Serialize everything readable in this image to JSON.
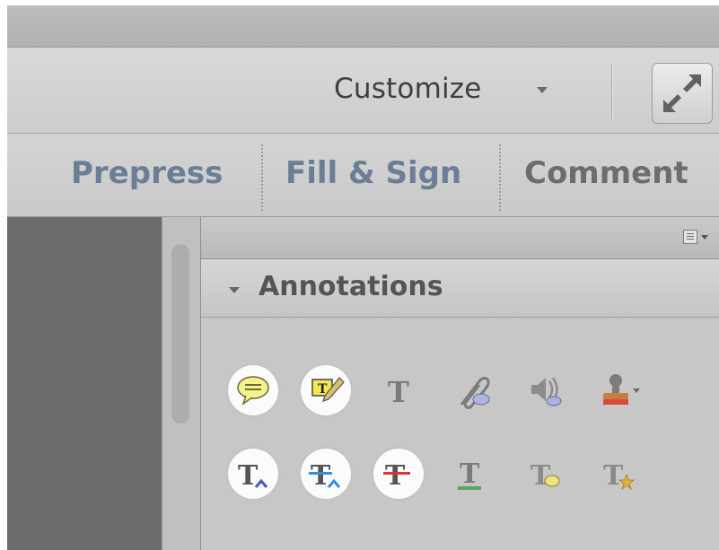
{
  "toolbar": {
    "customize_label": "Customize",
    "customize_menu_icon": "caret-down-icon",
    "expand_icon": "expand-arrows-icon"
  },
  "tabs": [
    {
      "label": "Prepress"
    },
    {
      "label": "Fill & Sign"
    },
    {
      "label": "Comment"
    }
  ],
  "panel": {
    "options_icon": "panel-options-icon",
    "section_title": "Annotations",
    "row1": [
      "sticky-note-icon",
      "highlight-text-icon",
      "add-text-box-icon",
      "attach-file-icon",
      "record-audio-icon",
      "stamp-icon"
    ],
    "row2": [
      "insert-text-icon",
      "replace-text-icon",
      "strikethrough-icon",
      "underline-icon",
      "add-note-to-text-icon",
      "text-correction-markup-icon"
    ],
    "glyph_T": "T",
    "colors": {
      "tab_active": "#6b7e96",
      "tab_inactive": "#6d6d6d",
      "note_yellow": "#f6f18a",
      "insert_blue": "#4a54c4",
      "replace_blue": "#2f8fe0",
      "strike_red": "#e0353a",
      "underline_green": "#5aa85a"
    }
  }
}
